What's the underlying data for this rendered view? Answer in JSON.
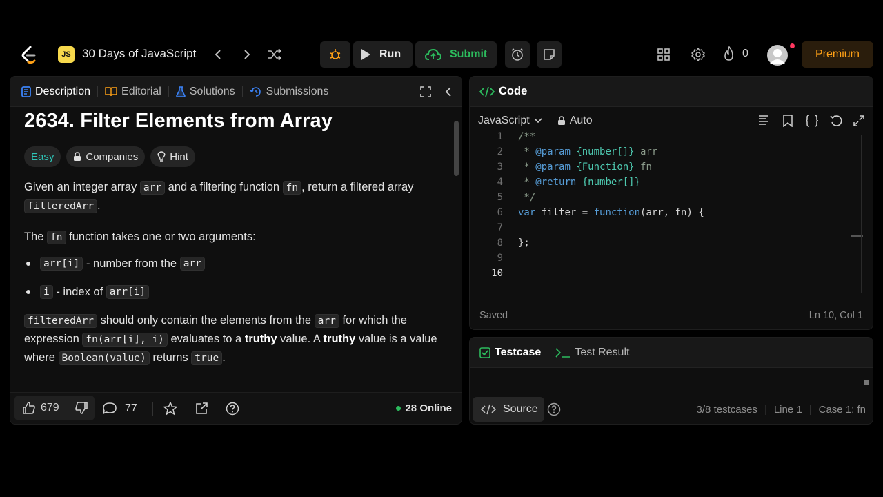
{
  "topbar": {
    "course_title": "30 Days of JavaScript",
    "course_icon_text": "JS",
    "run_label": "Run",
    "submit_label": "Submit",
    "streak_count": "0",
    "premium_label": "Premium"
  },
  "left_tabs": {
    "description": "Description",
    "editorial": "Editorial",
    "solutions": "Solutions",
    "submissions": "Submissions"
  },
  "problem": {
    "title": "2634. Filter Elements from Array",
    "tags": {
      "difficulty": "Easy",
      "companies": "Companies",
      "hint": "Hint"
    },
    "p1": {
      "a": "Given an integer array ",
      "arr": "arr",
      "b": " and a filtering function ",
      "fn": "fn",
      "c": ", return a filtered array ",
      "filteredArr": "filteredArr",
      "d": "."
    },
    "p2": {
      "a": "The ",
      "fn": "fn",
      "b": " function takes one or two arguments:"
    },
    "bullets": [
      {
        "code": "arr[i]",
        "text": " - number from the ",
        "code2": "arr"
      },
      {
        "code": "i",
        "text": " - index of ",
        "code2": "arr[i]"
      }
    ],
    "p3": {
      "filteredArr": "filteredArr",
      "a": " should only contain the elements from the ",
      "arr": "arr",
      "b": " for which the expression ",
      "call": "fn(arr[i], i)",
      "c": " evaluates to a ",
      "truthy1": "truthy",
      "d": " value. A ",
      "truthy2": "truthy",
      "e": " value is a value where ",
      "bool": "Boolean(value)",
      "f": " returns ",
      "true": "true",
      "g": "."
    }
  },
  "left_footer": {
    "likes": "679",
    "comments": "77",
    "online": "28 Online"
  },
  "code_panel": {
    "title": "Code",
    "language": "JavaScript",
    "mode": "Auto",
    "lines": [
      {
        "n": "1",
        "text": "/**"
      },
      {
        "n": "2",
        "text": " * @param {number[]} arr"
      },
      {
        "n": "3",
        "text": " * @param {Function} fn"
      },
      {
        "n": "4",
        "text": " * @return {number[]}"
      },
      {
        "n": "5",
        "text": " */"
      },
      {
        "n": "6",
        "text": "var filter = function(arr, fn) {"
      },
      {
        "n": "7",
        "text": ""
      },
      {
        "n": "8",
        "text": "};"
      },
      {
        "n": "9",
        "text": ""
      },
      {
        "n": "10",
        "text": ""
      }
    ],
    "saved": "Saved",
    "cursor": "Ln 10, Col 1"
  },
  "test_panel": {
    "testcase_tab": "Testcase",
    "result_tab": "Test Result",
    "source_label": "Source",
    "testcases": "3/8 testcases",
    "line": "Line 1",
    "case": "Case 1: fn"
  },
  "colors": {
    "accent_green": "#2cbb5d",
    "premium": "#ffa116",
    "easy": "#2ec4b6",
    "blue_icon": "#3b82f6"
  },
  "icons": [
    "logo-icon",
    "chevron-left-icon",
    "chevron-right-icon",
    "shuffle-icon",
    "debug-icon",
    "play-icon",
    "cloud-upload-icon",
    "alarm-icon",
    "note-icon",
    "grid-icon",
    "gear-icon",
    "flame-icon",
    "doc-icon",
    "book-icon",
    "flask-icon",
    "history-icon",
    "expand-icon",
    "collapse-icon",
    "lock-icon",
    "lightbulb-icon",
    "thumb-up-icon",
    "thumb-down-icon",
    "comment-icon",
    "star-icon",
    "share-icon",
    "help-icon",
    "code-icon",
    "chevron-down-icon",
    "format-icon",
    "bookmark-icon",
    "braces-icon",
    "undo-icon",
    "maximize-icon",
    "check-box-icon",
    "terminal-icon"
  ]
}
